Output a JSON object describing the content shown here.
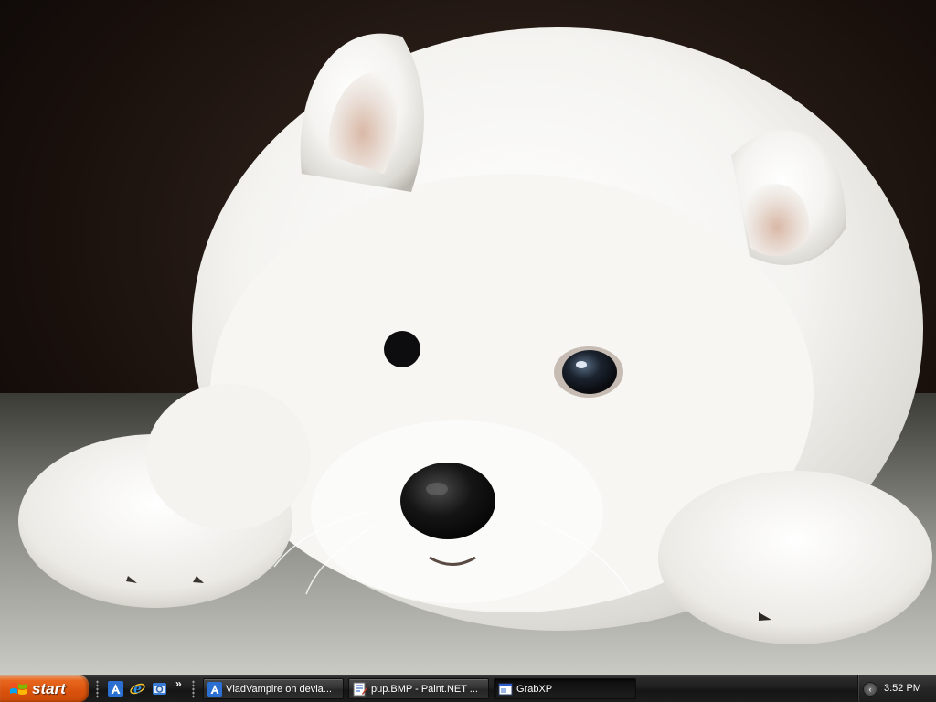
{
  "desktop": {
    "wallpaper": "white-fluffy-puppy-photo"
  },
  "taskbar": {
    "start_label": "start",
    "quick_launch": [
      {
        "icon": "deviantart-a-icon"
      },
      {
        "icon": "internet-explorer-icon"
      },
      {
        "icon": "windows-explorer-icon"
      }
    ],
    "quick_launch_overflow": "»",
    "tasks": [
      {
        "label": "VladVampire on devia...",
        "icon": "deviantart-a-icon",
        "active": false
      },
      {
        "label": "pup.BMP - Paint.NET ...",
        "icon": "paint-net-icon",
        "active": false
      },
      {
        "label": "GrabXP",
        "icon": "grabxp-window-icon",
        "active": true
      }
    ],
    "tray": {
      "expand_symbol": "‹",
      "clock": "3:52 PM"
    }
  },
  "colors": {
    "start_orange": "#d9520d",
    "taskbar_dark": "#1f1f1f"
  }
}
